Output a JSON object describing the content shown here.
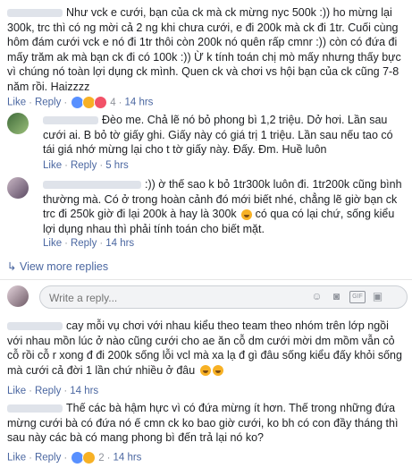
{
  "comments": [
    {
      "text": "Như vck e cưới, bạn của ck mà ck mừng nyc 500k :)) ho mừng lại 300k, trc thì có ng mời cả 2 ng khi chưa cưới, e đi 200k mà ck đi 1tr. Cuối cùng hôm đám cưới vck e nó đi 1tr thôi còn 200k nó quên rấp cmnr :)) còn có đứa đi mấy trăm ak mà bạn ck đi có 100k :)) Ừ k tính toán chị mò mấy nhưng thấy bực vì chúng nó toàn lợi dụng ck mình. Quen ck và chơi vs hội bạn của ck cũng 7-8 năm rồi. Haizzzz",
      "like": "Like",
      "reply": "Reply",
      "reaction_count": "4",
      "time": "14 hrs"
    },
    {
      "text": "Đèo me. Chả lẽ nó bỏ phong bì 1,2 triệu. Dở hơi. Lần sau cưới ai. B bỏ tờ giấy ghi. Giấy này có giá trị 1 triệu. Lần sau nếu tao có tái giá nhớ mừng lại cho t tờ giấy này. Đấy. Đm. Huề luôn",
      "like": "Like",
      "reply": "Reply",
      "time": "5 hrs"
    },
    {
      "text": ":)) ờ thế sao k bỏ 1tr300k luôn đi. 1tr200k cũng bình thường mà. Có ở trong hoàn cảnh đó mới biết nhé, chẳng lẽ giờ bạn ck trc đi 250k giờ đi lại 200k à hay là 300k",
      "text_cont": "có qua có lại chứ, sống kiểu lợi dụng nhau thì phải tính toán cho biết mặt.",
      "like": "Like",
      "reply": "Reply",
      "time": "14 hrs"
    },
    {
      "text": "cay mỗi vụ chơi với nhau kiểu theo team theo nhóm trên lớp ngồi với nhau mồn lúc ở nào cũng cưới cho ae ăn cỗ dm cưới mời dm mồm vẫn cỏ cỗ rồi cỗ r xong đ đi 200k sống lỗi vcl mà xa lạ đ gì đâu sống kiểu đấy khỏi sống mà cưới cả đời 1 lần chứ nhiều ở đâu",
      "like": "Like",
      "reply": "Reply",
      "time": "14 hrs"
    },
    {
      "text": "Thế các bà hậm hực vì có đứa mừng ít hơn. Thế trong những đứa mừng cưới bà có đứa nó ế cmn ck ko bao giờ cưới, ko bh có con đầy tháng thì sau này các bà có mang phong bì đến trả lại nó ko?",
      "like": "Like",
      "reply": "Reply",
      "reaction_count": "2",
      "time": "14 hrs"
    }
  ],
  "view_more_replies": "View more replies",
  "write_box": {
    "placeholder": "Write a reply..."
  },
  "colors": {
    "link": "#4b67a1",
    "meta": "#90949c",
    "like": "#5890ff",
    "haha": "#f7b125",
    "love": "#f25268"
  },
  "icons": [
    "reply-arrow-icon",
    "emoji-icon",
    "camera-icon",
    "gif-icon",
    "sticker-icon",
    "like-reaction-icon",
    "haha-reaction-icon",
    "love-reaction-icon"
  ]
}
